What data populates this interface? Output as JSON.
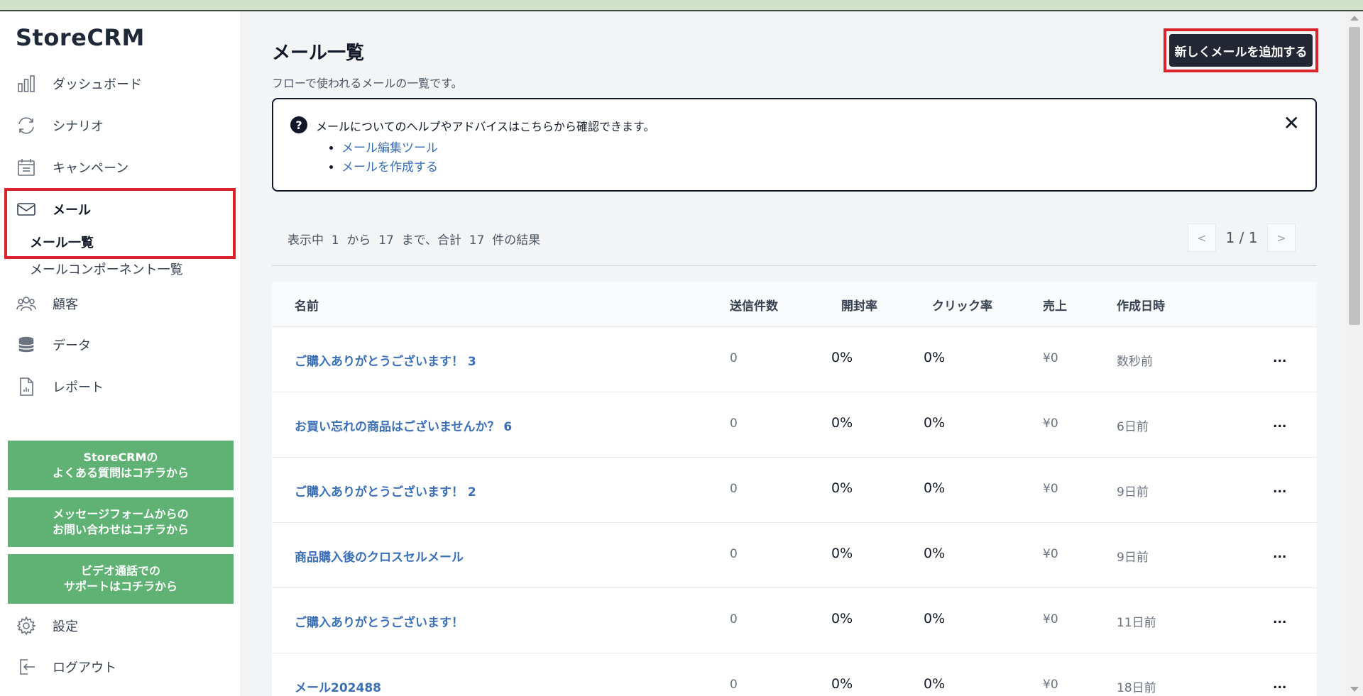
{
  "app": {
    "logo": "StoreCRM"
  },
  "sidebar": {
    "items": [
      {
        "label": "ダッシュボード",
        "icon": "bar-chart-icon"
      },
      {
        "label": "シナリオ",
        "icon": "refresh-icon"
      },
      {
        "label": "キャンペーン",
        "icon": "calendar-icon"
      },
      {
        "label": "メール",
        "icon": "mail-icon"
      },
      {
        "label": "顧客",
        "icon": "users-icon"
      },
      {
        "label": "データ",
        "icon": "database-icon"
      },
      {
        "label": "レポート",
        "icon": "report-icon"
      }
    ],
    "subitems": [
      {
        "label": "メール一覧"
      },
      {
        "label": "メールコンポーネント一覧"
      }
    ],
    "support_buttons": [
      {
        "label": "StoreCRMの\nよくある質問はコチラから"
      },
      {
        "label": "メッセージフォームからの\nお問い合わせはコチラから"
      },
      {
        "label": "ビデオ通話での\nサポートはコチラから"
      }
    ],
    "footer_items": [
      {
        "label": "設定",
        "icon": "gear-icon"
      },
      {
        "label": "ログアウト",
        "icon": "logout-icon"
      }
    ]
  },
  "main": {
    "title": "メール一覧",
    "description": "フローで使われるメールの一覧です。",
    "add_button": "新しくメールを追加する",
    "help": {
      "text": "メールについてのヘルプやアドバイスはこちらから確認できます。",
      "links": [
        "メール編集ツール",
        "メールを作成する"
      ],
      "close": "✕"
    },
    "results_text": "表示中  1  から  17  まで、合計  17  件の結果",
    "pagination": {
      "prev": "<",
      "current": "1 / 1",
      "next": ">"
    },
    "table": {
      "headers": {
        "name": "名前",
        "sent": "送信件数",
        "open": "開封率",
        "click": "クリック率",
        "sales": "売上",
        "created": "作成日時"
      },
      "rows": [
        {
          "name": "ご購入ありがとうございます！ 3",
          "sent": "0",
          "open": "0%",
          "click": "0%",
          "sales": "¥0",
          "created": "数秒前",
          "more": "..."
        },
        {
          "name": "お買い忘れの商品はございませんか？ 6",
          "sent": "0",
          "open": "0%",
          "click": "0%",
          "sales": "¥0",
          "created": "6日前",
          "more": "..."
        },
        {
          "name": "ご購入ありがとうございます！ 2",
          "sent": "0",
          "open": "0%",
          "click": "0%",
          "sales": "¥0",
          "created": "9日前",
          "more": "..."
        },
        {
          "name": "商品購入後のクロスセルメール",
          "sent": "0",
          "open": "0%",
          "click": "0%",
          "sales": "¥0",
          "created": "9日前",
          "more": "..."
        },
        {
          "name": "ご購入ありがとうございます！",
          "sent": "0",
          "open": "0%",
          "click": "0%",
          "sales": "¥0",
          "created": "11日前",
          "more": "..."
        },
        {
          "name": "メール202488",
          "sent": "0",
          "open": "0%",
          "click": "0%",
          "sales": "¥0",
          "created": "18日前",
          "more": "..."
        }
      ]
    }
  },
  "colors": {
    "accent_green": "#5fb274",
    "highlight_red": "#d9242b",
    "link_blue": "#3b6fb6",
    "dark_button": "#232733"
  }
}
